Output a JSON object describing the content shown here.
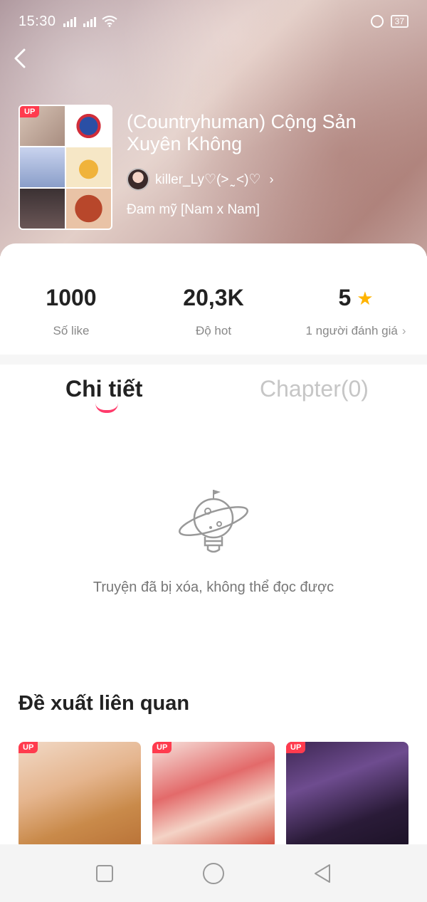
{
  "status_bar": {
    "time": "15:30",
    "battery": "37"
  },
  "story": {
    "title": "(Countryhuman) Cộng Sản Xuyên Không",
    "author": "killer_Ly♡(> ̰ <)♡",
    "genre": "Đam mỹ [Nam x Nam]",
    "cover_badge": "UP"
  },
  "stats": {
    "likes": {
      "value": "1000",
      "label": "Số like"
    },
    "hot": {
      "value": "20,3K",
      "label": "Độ hot"
    },
    "rating": {
      "value": "5",
      "label": "1 người đánh giá"
    }
  },
  "tabs": {
    "detail": "Chi tiết",
    "chapter": "Chapter(0)"
  },
  "empty_state": {
    "message": "Truyện đã bị xóa, không thể đọc được"
  },
  "related": {
    "title": "Đề xuất liên quan",
    "items": [
      {
        "badge": "UP"
      },
      {
        "badge": "UP"
      },
      {
        "badge": "UP"
      }
    ]
  },
  "colors": {
    "accent": "#ff3b6b",
    "badge": "#ff3b4e",
    "star": "#ffb400"
  },
  "icons": {
    "back": "chevron-left-icon",
    "star": "star-icon",
    "empty": "planet-lightbulb-icon",
    "nav_recent": "square-icon",
    "nav_home": "circle-icon",
    "nav_back": "triangle-back-icon"
  }
}
